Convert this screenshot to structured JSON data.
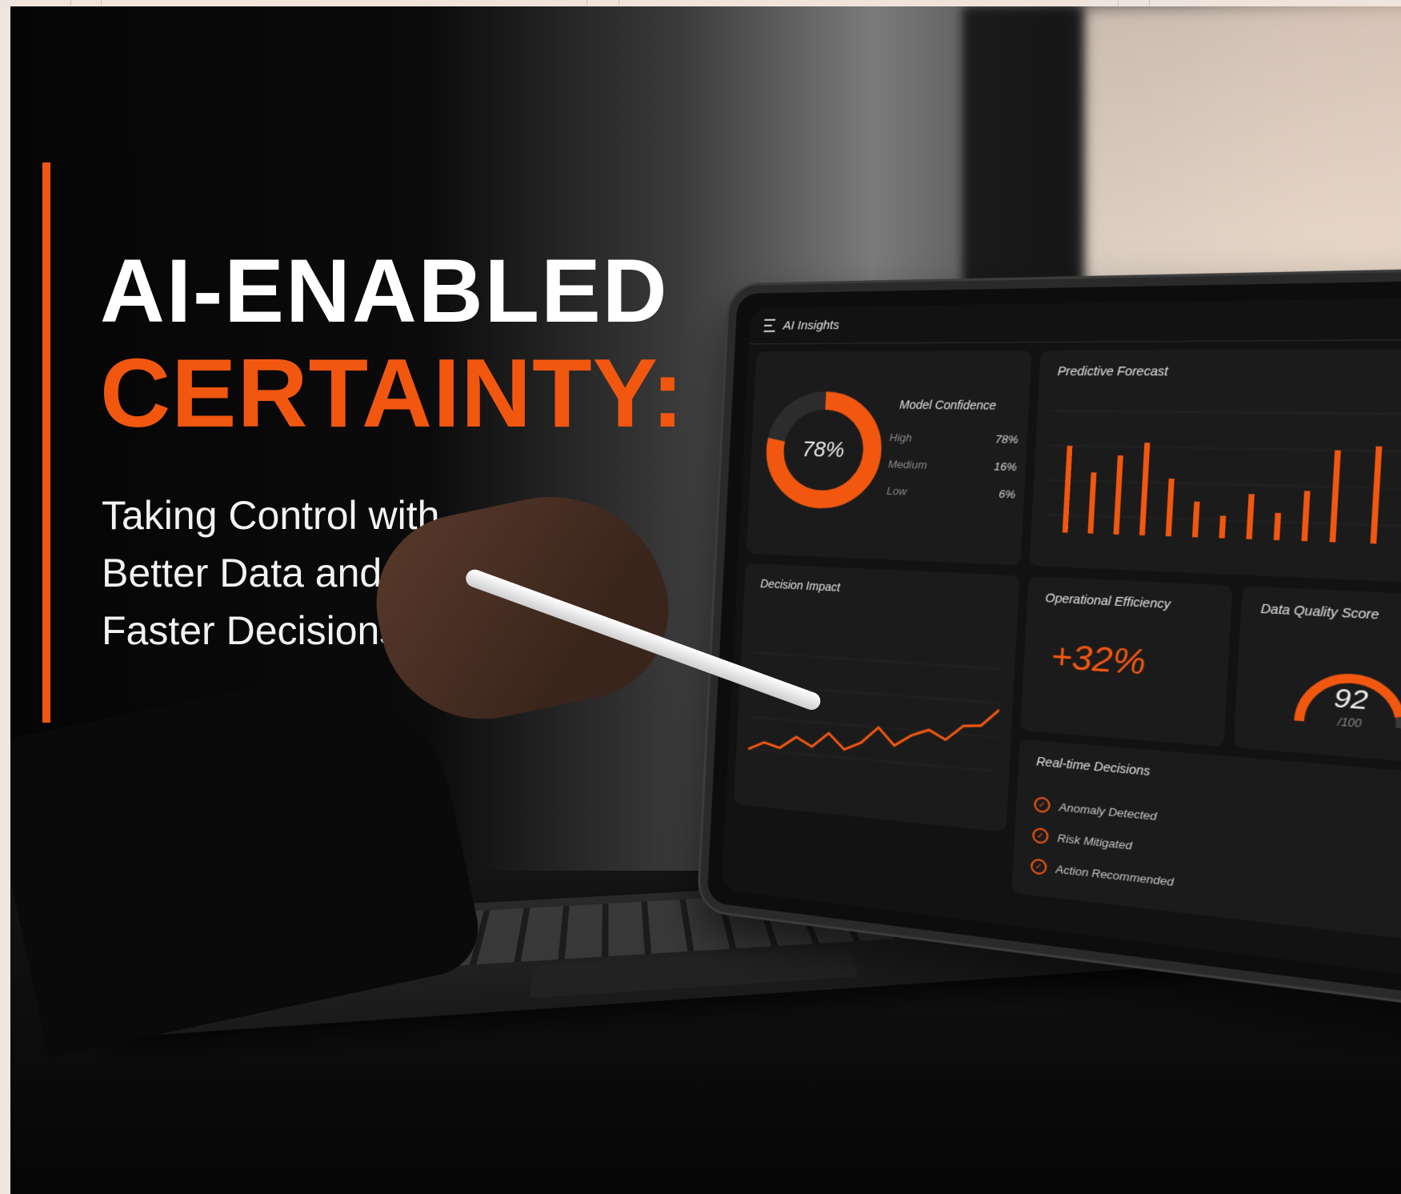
{
  "headline": {
    "line1": "AI-ENABLED",
    "line2": "CERTAINTY:"
  },
  "subheadline": {
    "lines": [
      "Taking Control with",
      "Better Data and",
      "Faster Decisions"
    ]
  },
  "tablet": {
    "app_title": "AI Insights",
    "model_confidence": {
      "title": "Model Confidence",
      "center_value": "78%",
      "breakdown": [
        {
          "label": "High",
          "value": "78%"
        },
        {
          "label": "Medium",
          "value": "16%"
        },
        {
          "label": "Low",
          "value": "6%"
        }
      ]
    },
    "predictive_forecast": {
      "title": "Predictive Forecast"
    },
    "operational_efficiency": {
      "title": "Operational Efficiency",
      "value": "+32%"
    },
    "data_quality": {
      "title": "Data Quality Score",
      "value": "92",
      "max_label": "/100"
    },
    "decision_impact": {
      "title": "Decision Impact"
    },
    "realtime_decisions": {
      "title": "Real-time Decisions",
      "items": [
        "Anomaly Detected",
        "Risk Mitigated",
        "Action Recommended"
      ]
    }
  },
  "colors": {
    "accent": "#f25710",
    "headline_white": "#ffffff"
  }
}
